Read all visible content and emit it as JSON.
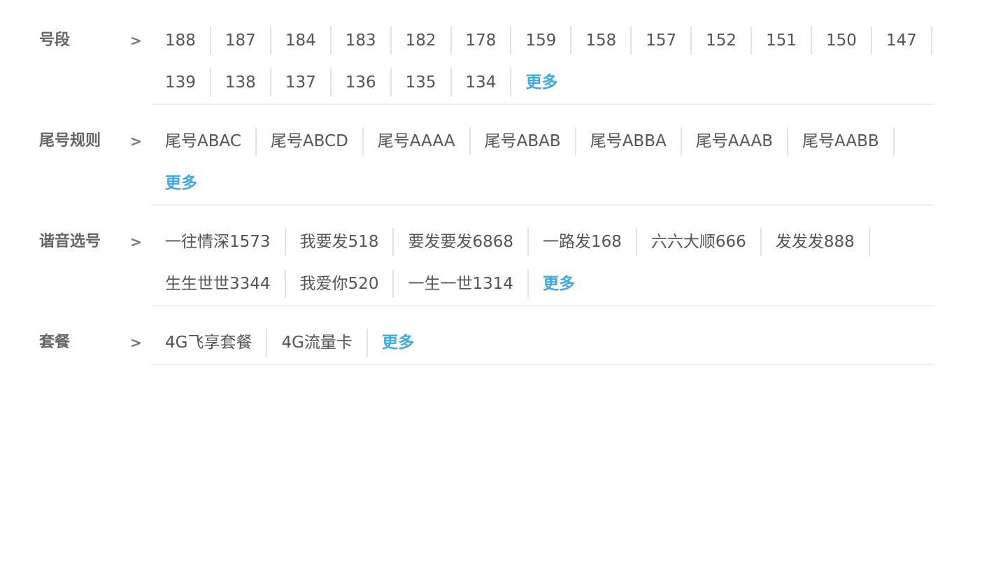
{
  "filters": [
    {
      "label": "号段",
      "arrow": ">",
      "items": [
        "188",
        "187",
        "184",
        "183",
        "182",
        "178",
        "159",
        "158",
        "157",
        "152",
        "151",
        "150",
        "147",
        "139",
        "138",
        "137",
        "136",
        "135",
        "134"
      ],
      "more": "更多"
    },
    {
      "label": "尾号规则",
      "arrow": ">",
      "items": [
        "尾号ABAC",
        "尾号ABCD",
        "尾号AAAA",
        "尾号ABAB",
        "尾号ABBA",
        "尾号AAAB",
        "尾号AABB"
      ],
      "more": "更多"
    },
    {
      "label": "谐音选号",
      "arrow": ">",
      "items": [
        "一往情深1573",
        "我要发518",
        "要发要发6868",
        "一路发168",
        "六六大顺666",
        "发发发888",
        "生生世世3344",
        "我爱你520",
        "一生一世1314"
      ],
      "more": "更多"
    },
    {
      "label": "套餐",
      "arrow": ">",
      "items": [
        "4G飞享套餐",
        "4G流量卡"
      ],
      "more": "更多"
    }
  ],
  "colors": {
    "link": "#3fa9e8",
    "text": "#555555",
    "label": "#666666",
    "divider": "#e2e2e2"
  }
}
